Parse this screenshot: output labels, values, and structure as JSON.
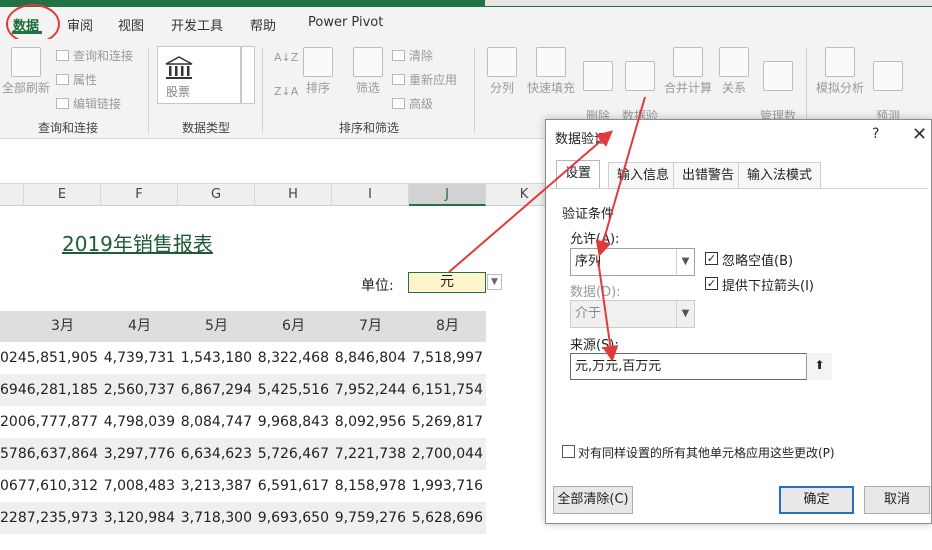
{
  "ribbon_tabs": [
    {
      "label": "数据",
      "active": true
    },
    {
      "label": "审阅"
    },
    {
      "label": "视图"
    },
    {
      "label": "开发工具"
    },
    {
      "label": "帮助"
    },
    {
      "label": "Power Pivot"
    }
  ],
  "ribbon": {
    "query_group": {
      "refresh_all": "全部刷新",
      "query_connections": "查询和连接",
      "properties": "属性",
      "edit_links": "编辑链接",
      "label": "查询和连接"
    },
    "data_type_group": {
      "stock": "股票",
      "label": "数据类型"
    },
    "sort_filter_group": {
      "sort": "排序",
      "filter": "筛选",
      "clear": "清除",
      "reapply": "重新应用",
      "advanced": "高级",
      "label": "排序和筛选"
    },
    "data_tools_group": {
      "split": "分列",
      "flash_fill": "快速填充",
      "remove_duplicates": "删除\n重复值",
      "data_validation": "数据验\n证",
      "consolidate": "合并计算",
      "relationships": "关系",
      "manage_data_model": "管理数\n据模型"
    },
    "forecast_group": {
      "what_if": "模拟分析",
      "forecast_sheet": "预测\n工作表"
    }
  },
  "columns": [
    "E",
    "F",
    "G",
    "H",
    "I",
    "J",
    "K"
  ],
  "selected_column": "J",
  "sheet": {
    "title": "2019年销售报表",
    "unit_label": "单位:",
    "unit_value": "元",
    "headers": [
      "3月",
      "4月",
      "5月",
      "6月",
      "7月",
      "8月"
    ],
    "rows": [
      {
        "partial": "024",
        "values": [
          "5,851,905",
          "4,739,731",
          "1,543,180",
          "8,322,468",
          "8,846,804",
          "7,518,997"
        ]
      },
      {
        "partial": "694",
        "values": [
          "6,281,185",
          "2,560,737",
          "6,867,294",
          "5,425,516",
          "7,952,244",
          "6,151,754"
        ]
      },
      {
        "partial": "200",
        "values": [
          "6,777,877",
          "4,798,039",
          "8,084,747",
          "9,968,843",
          "8,092,956",
          "5,269,817"
        ]
      },
      {
        "partial": "578",
        "values": [
          "6,637,864",
          "3,297,776",
          "6,634,623",
          "5,726,467",
          "7,221,738",
          "2,700,044"
        ]
      },
      {
        "partial": "067",
        "values": [
          "7,610,312",
          "7,008,483",
          "3,213,387",
          "6,591,617",
          "8,158,978",
          "1,993,716"
        ]
      },
      {
        "partial": "228",
        "values": [
          "7,235,973",
          "3,120,984",
          "3,718,300",
          "9,693,650",
          "9,759,276",
          "5,628,696"
        ]
      }
    ]
  },
  "dialog": {
    "title": "数据验证",
    "help": "?",
    "close": "✕",
    "tabs": [
      "设置",
      "输入信息",
      "出错警告",
      "输入法模式"
    ],
    "section": "验证条件",
    "allow_label": "允许(A):",
    "allow_value": "序列",
    "ignore_blank": "忽略空值(B)",
    "ignore_blank_checked": true,
    "dropdown_arrow": "提供下拉箭头(I)",
    "dropdown_arrow_checked": true,
    "data_label": "数据(D):",
    "data_value": "介于",
    "source_label": "来源(S):",
    "source_value": "元,万元,百万元",
    "apply_all": "对有同样设置的所有其他单元格应用这些更改(P)",
    "apply_all_checked": false,
    "clear_all": "全部清除(C)",
    "ok": "确定",
    "cancel": "取消"
  },
  "colors": {
    "accent": "#217346",
    "annotation": "#e23a3a",
    "primary_button_border": "#2a6cc8"
  }
}
